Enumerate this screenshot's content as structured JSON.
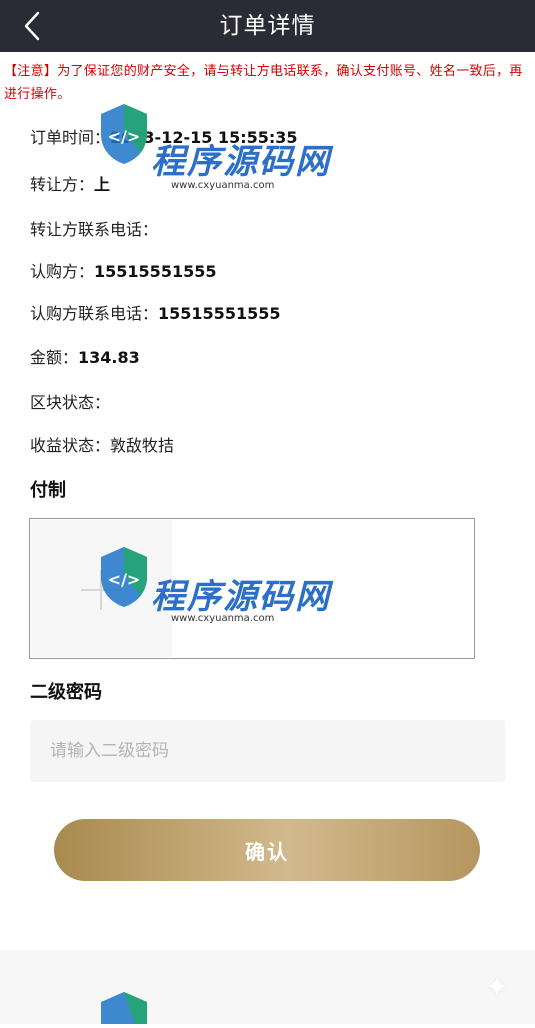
{
  "header": {
    "title": "订单详情"
  },
  "notice": "【注意】为了保证您的财产安全，请与转让方电话联系，确认支付账号、姓名一致后，再进行操作。",
  "order": {
    "time_label": "订单时间：",
    "time_value": "2023-12-15 15:55:35",
    "seller_label": "转让方：",
    "seller_value": "上",
    "seller_phone_label": "转让方联系电话：",
    "seller_phone_value": "",
    "buyer_label": "认购方：",
    "buyer_value": "15515551555",
    "buyer_phone_label": "认购方联系电话：",
    "buyer_phone_value": "15515551555",
    "amount_label": "金额：",
    "amount_value": "134.83",
    "block_status_label": "区块状态：",
    "block_status_value": "",
    "earning_status_label": "收益状态：",
    "earning_status_value": "敦敌牧拮"
  },
  "payment": {
    "section_title": "付制"
  },
  "password": {
    "section_title": "二级密码",
    "placeholder": "请输入二级密码"
  },
  "actions": {
    "confirm_label": "确认"
  },
  "watermark": {
    "brand": "程序源码网",
    "url": "www.cxyuanma.com"
  },
  "icons": {
    "back": "chevron-left-icon",
    "upload": "plus-icon",
    "footer": "sparkle-icon"
  },
  "colors": {
    "header_bg": "#2b2b35",
    "notice": "#d40000",
    "button_gold": "#c3a878"
  }
}
